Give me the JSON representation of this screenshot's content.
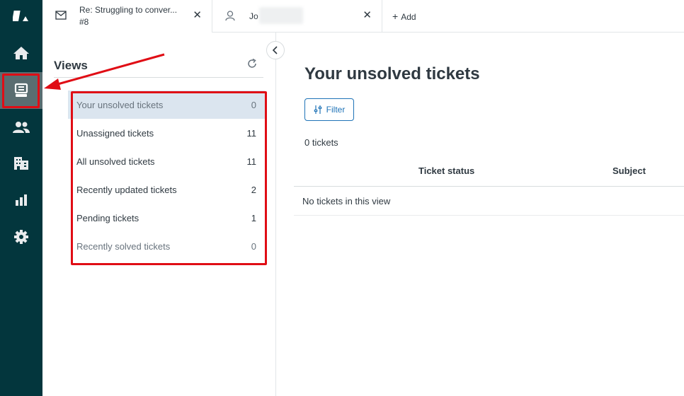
{
  "rail": {
    "items": [
      {
        "name": "logo",
        "icon": "zendesk-logo-icon"
      },
      {
        "name": "home",
        "icon": "home-icon"
      },
      {
        "name": "views",
        "icon": "views-icon",
        "active": true
      },
      {
        "name": "customers",
        "icon": "users-icon"
      },
      {
        "name": "organizations",
        "icon": "building-icon"
      },
      {
        "name": "reporting",
        "icon": "bar-chart-icon"
      },
      {
        "name": "admin",
        "icon": "gear-icon"
      }
    ]
  },
  "tabs": [
    {
      "title": "Re: Struggling to conver...",
      "subtitle": "#8",
      "icon": "mail-icon"
    },
    {
      "title": "Jo",
      "icon": "user-icon"
    }
  ],
  "add_tab_label": "Add",
  "views_panel": {
    "title": "Views",
    "items": [
      {
        "label": "Your unsolved tickets",
        "count": "0"
      },
      {
        "label": "Unassigned tickets",
        "count": "11"
      },
      {
        "label": "All unsolved tickets",
        "count": "11"
      },
      {
        "label": "Recently updated tickets",
        "count": "2"
      },
      {
        "label": "Pending tickets",
        "count": "1"
      },
      {
        "label": "Recently solved tickets",
        "count": "0"
      }
    ]
  },
  "main": {
    "title": "Your unsolved tickets",
    "filter_label": "Filter",
    "ticket_count": "0 tickets",
    "columns": [
      "Ticket status",
      "Subject"
    ],
    "empty_message": "No tickets in this view"
  },
  "colors": {
    "rail_bg": "#03363d",
    "rail_active": "#5a6d71",
    "accent_blue": "#1f73b7",
    "annotation_red": "#e00d15",
    "selected_view_bg": "#dbe5ef"
  }
}
